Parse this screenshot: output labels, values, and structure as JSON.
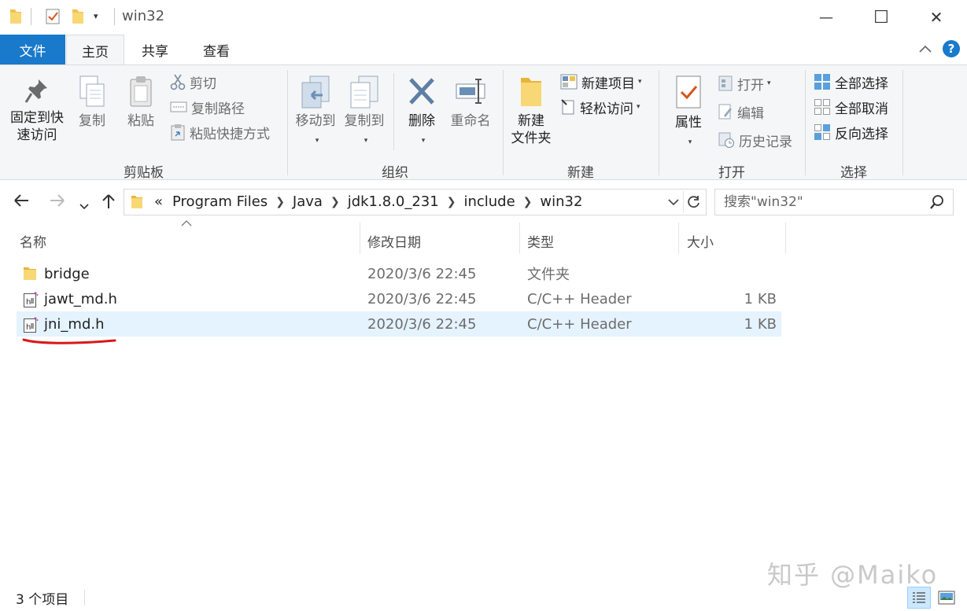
{
  "window": {
    "title": "win32",
    "minimize": "—",
    "maximize": "☐",
    "close": "✕"
  },
  "tabs": [
    {
      "label": "文件"
    },
    {
      "label": "主页"
    },
    {
      "label": "共享"
    },
    {
      "label": "查看"
    }
  ],
  "ribbon": {
    "clipboard": {
      "pin": "固定到快\n速访问",
      "pin_line1": "固定到快",
      "pin_line2": "速访问",
      "copy": "复制",
      "paste": "粘贴",
      "cut": "剪切",
      "copy_path": "复制路径",
      "paste_shortcut": "粘贴快捷方式",
      "label": "剪贴板"
    },
    "organize": {
      "move_to": "移动到",
      "copy_to": "复制到",
      "delete": "删除",
      "rename": "重命名",
      "label": "组织"
    },
    "new": {
      "new_folder_line1": "新建",
      "new_folder_line2": "文件夹",
      "new_item": "新建项目",
      "easy_access": "轻松访问",
      "label": "新建"
    },
    "open": {
      "properties": "属性",
      "open": "打开",
      "edit": "编辑",
      "history": "历史记录",
      "label": "打开"
    },
    "select": {
      "select_all": "全部选择",
      "select_none": "全部取消",
      "invert": "反向选择",
      "label": "选择"
    }
  },
  "address": {
    "overflow": "«",
    "crumbs": [
      "Program Files",
      "Java",
      "jdk1.8.0_231",
      "include",
      "win32"
    ]
  },
  "search": {
    "placeholder": "搜索\"win32\""
  },
  "columns": {
    "name": "名称",
    "date": "修改日期",
    "type": "类型",
    "size": "大小"
  },
  "files": [
    {
      "name": "bridge",
      "date": "2020/3/6 22:45",
      "type": "文件夹",
      "size": "",
      "icon": "folder-icon"
    },
    {
      "name": "jawt_md.h",
      "date": "2020/3/6 22:45",
      "type": "C/C++ Header",
      "size": "1 KB",
      "icon": "header-file-icon"
    },
    {
      "name": "jni_md.h",
      "date": "2020/3/6 22:45",
      "type": "C/C++ Header",
      "size": "1 KB",
      "icon": "header-file-icon",
      "selected": true
    }
  ],
  "status": {
    "count": "3 个项目"
  },
  "watermark": "知乎 @Maiko",
  "colors": {
    "accent": "#1979ca",
    "ribbon_bg": "#f5f6f7",
    "selection": "#e5f3ff",
    "annotation_red": "#d7191c",
    "folder_yellow": "#f8d775"
  }
}
